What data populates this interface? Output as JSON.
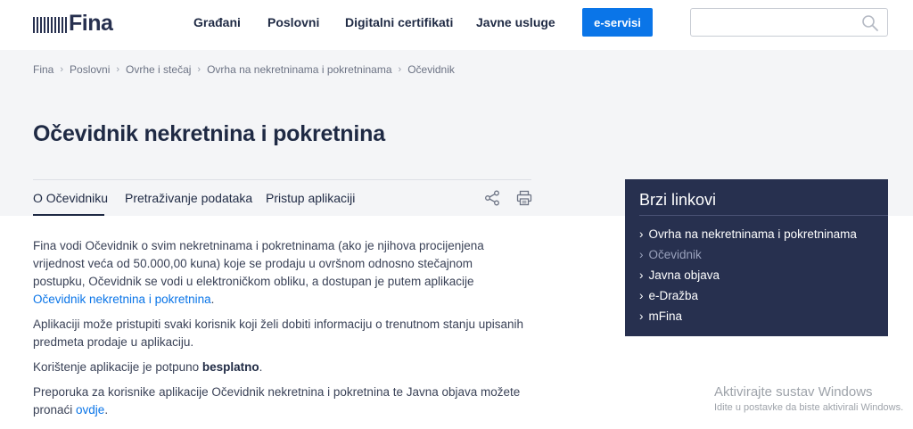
{
  "header": {
    "logo_text": "Fina",
    "nav": [
      {
        "label": "Građani"
      },
      {
        "label": "Poslovni"
      },
      {
        "label": "Digitalni certifikati"
      },
      {
        "label": "Javne usluge"
      }
    ],
    "eservisi_label": "e-servisi",
    "search": {
      "value": "",
      "placeholder": ""
    }
  },
  "breadcrumb": [
    "Fina",
    "Poslovni",
    "Ovrhe i stečaj",
    "Ovrha na nekretninama i pokretninama",
    "Očevidnik"
  ],
  "page_title": "Očevidnik nekretnina i pokretnina",
  "tabs": [
    {
      "label": "O Očevidniku",
      "active": true
    },
    {
      "label": "Pretraživanje podataka",
      "active": false
    },
    {
      "label": "Pristup aplikaciji",
      "active": false
    }
  ],
  "content": {
    "p1_text": "Fina vodi Očevidnik o svim nekretninama i pokretninama (ako je njihova procijenjena vrijednost veća od 50.000,00 kuna) koje se prodaju u ovršnom odnosno stečajnom postupku, Očevidnik se vodi u elektroničkom obliku, a dostupan je putem aplikacije ",
    "p1_link": "Očevidnik nekretnina i pokretnina",
    "p1_end": ".",
    "p2_text": "Aplikaciji može pristupiti svaki korisnik koji želi dobiti informaciju o trenutnom stanju upisanih predmeta prodaje u aplikaciju.",
    "p3_text": "Korištenje aplikacije je potpuno ",
    "p3_bold": "besplatno",
    "p3_end": ".",
    "p4_text": "Preporuka za korisnike aplikacije Očevidnik nekretnina i pokretnina te Javna objava možete pronaći ",
    "p4_link": "ovdje",
    "p4_end": "."
  },
  "quick_links": {
    "title": "Brzi linkovi",
    "items": [
      {
        "label": "Ovrha na nekretninama i pokretninama",
        "muted": false
      },
      {
        "label": "Očevidnik",
        "muted": true
      },
      {
        "label": "Javna objava",
        "muted": false
      },
      {
        "label": "e-Dražba",
        "muted": false
      },
      {
        "label": "mFina",
        "muted": false
      }
    ]
  },
  "watermark": {
    "title": "Aktivirajte sustav Windows",
    "subtitle": "Idite u postavke da biste aktivirali Windows."
  },
  "colors": {
    "primary_blue": "#0a75e8",
    "navy": "#27304f",
    "band_gray": "#f4f5f7"
  }
}
